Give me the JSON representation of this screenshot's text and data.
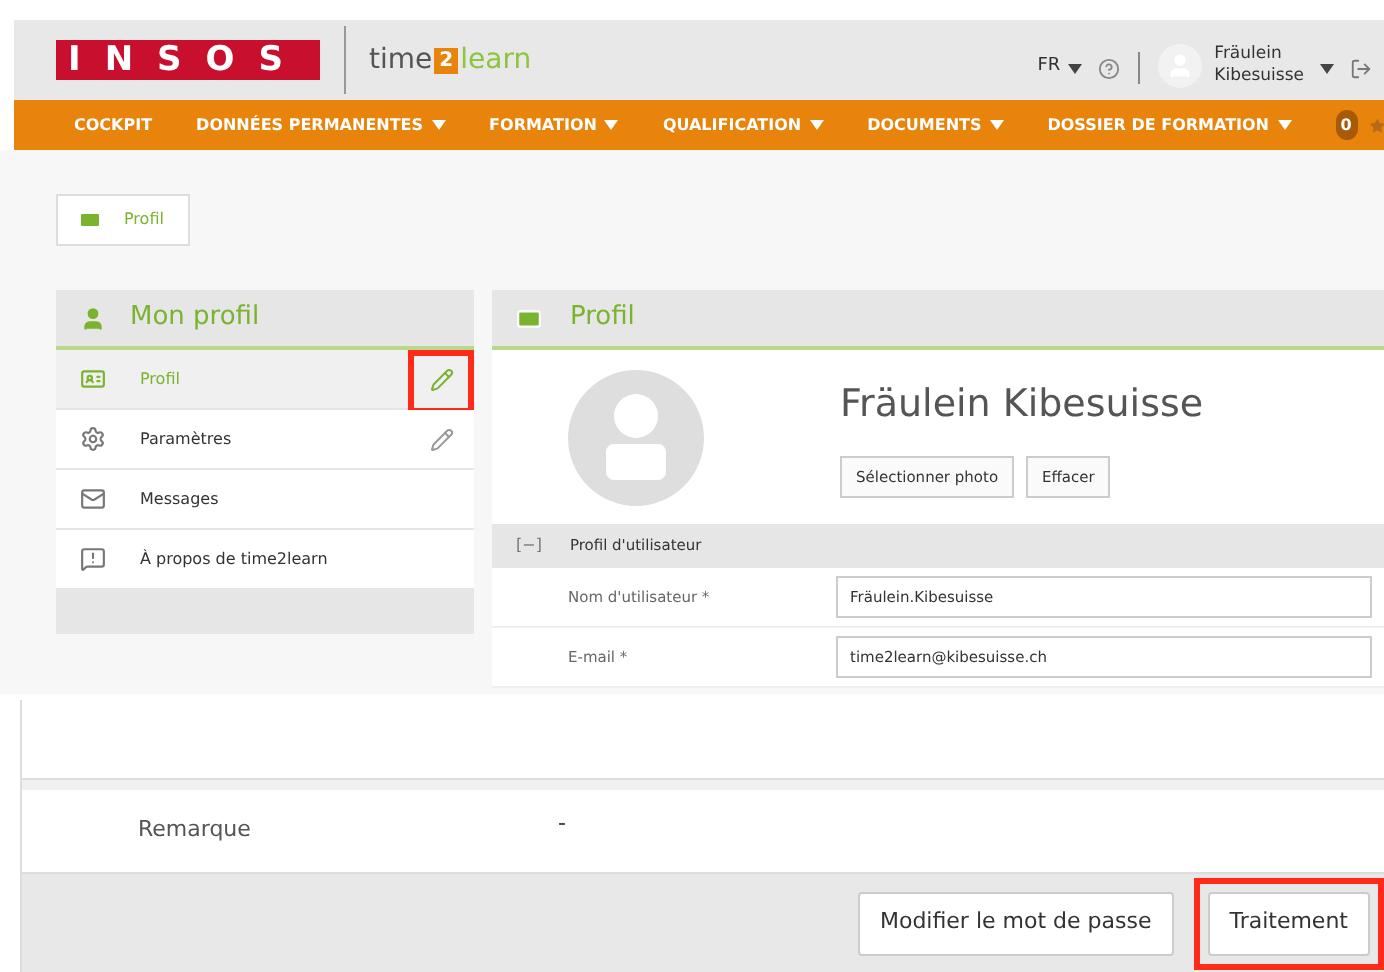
{
  "header": {
    "logo": "INSOS",
    "product": {
      "prefix": "time",
      "digit": "2",
      "suffix": "learn"
    },
    "language": "FR",
    "user": {
      "first_line": "Fräulein",
      "second_line": "Kibesuisse"
    }
  },
  "nav": {
    "items": [
      {
        "label": "COCKPIT",
        "dropdown": false
      },
      {
        "label": "DONNÉES PERMANENTES",
        "dropdown": true
      },
      {
        "label": "FORMATION",
        "dropdown": true
      },
      {
        "label": "QUALIFICATION",
        "dropdown": true
      },
      {
        "label": "DOCUMENTS",
        "dropdown": true
      },
      {
        "label": "DOSSIER DE FORMATION",
        "dropdown": true
      }
    ],
    "badge": "0"
  },
  "breadcrumb": [
    "Profil"
  ],
  "sidebar": {
    "title": "Mon profil",
    "items": [
      {
        "kind": "card",
        "label": "Profil",
        "selected": true,
        "editable": true,
        "highlighted": true
      },
      {
        "kind": "gear",
        "label": "Paramètres",
        "selected": false,
        "editable": true,
        "highlighted": false
      },
      {
        "kind": "mail",
        "label": "Messages",
        "selected": false,
        "editable": false,
        "highlighted": false
      },
      {
        "kind": "info",
        "label": "À propos de time2learn",
        "selected": false,
        "editable": false,
        "highlighted": false
      }
    ]
  },
  "profile": {
    "title": "Profil",
    "name": "Fräulein Kibesuisse",
    "photo_buttons": [
      "Sélectionner photo",
      "Effacer"
    ],
    "section": {
      "toggle": "[−]",
      "title": "Profil d'utilisateur",
      "expanded": true,
      "fields": [
        {
          "label": "Nom d'utilisateur *",
          "value": "Fräulein.Kibesuisse"
        },
        {
          "label": "E-mail *",
          "value": "time2learn@kibesuisse.ch"
        }
      ]
    }
  },
  "lower": {
    "remark": {
      "label": "Remarque",
      "value": "-"
    },
    "buttons": [
      {
        "label": "Modifier le mot de passe",
        "highlighted": false
      },
      {
        "label": "Traitement",
        "highlighted": true
      }
    ]
  }
}
